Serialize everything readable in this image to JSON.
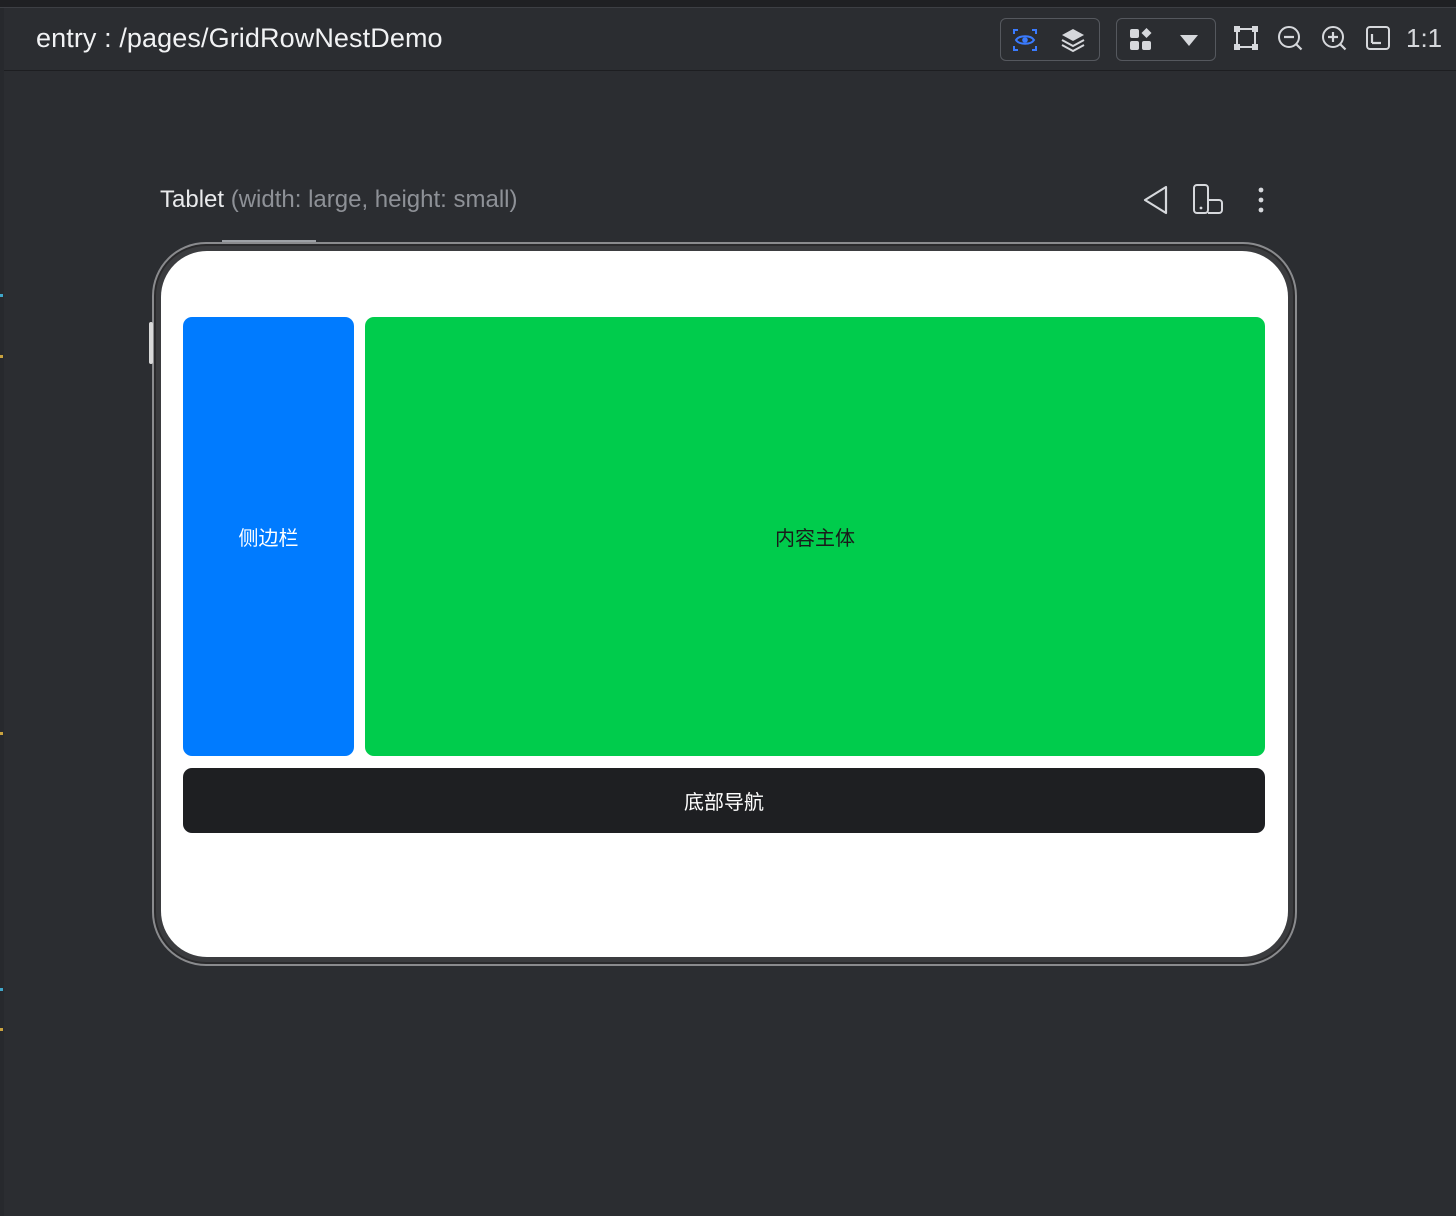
{
  "header": {
    "title": "entry : /pages/GridRowNestDemo",
    "ratio_label": "1:1",
    "icons": {
      "inspect": "eye-scan-icon",
      "layers": "layers-icon",
      "components": "component-grid-icon",
      "dropdown": "chevron-down-icon",
      "frame": "frame-select-icon",
      "zoom_out": "zoom-out-icon",
      "zoom_in": "zoom-in-icon",
      "fit": "fit-screen-icon"
    },
    "colors": {
      "accent": "#3a7bff",
      "icon": "#d6d8dc"
    }
  },
  "device": {
    "name": "Tablet",
    "description": "(width: large, height: small)",
    "icons": {
      "back": "triangle-back-icon",
      "rotate": "device-rotate-icon",
      "more": "more-vertical-icon"
    }
  },
  "screen": {
    "sidebar_label": "侧边栏",
    "content_label": "内容主体",
    "bottom_nav_label": "底部导航",
    "colors": {
      "sidebar": "#007bff",
      "content": "#00cc4c",
      "bottom_nav": "#1e1f22",
      "background": "#ffffff"
    }
  }
}
